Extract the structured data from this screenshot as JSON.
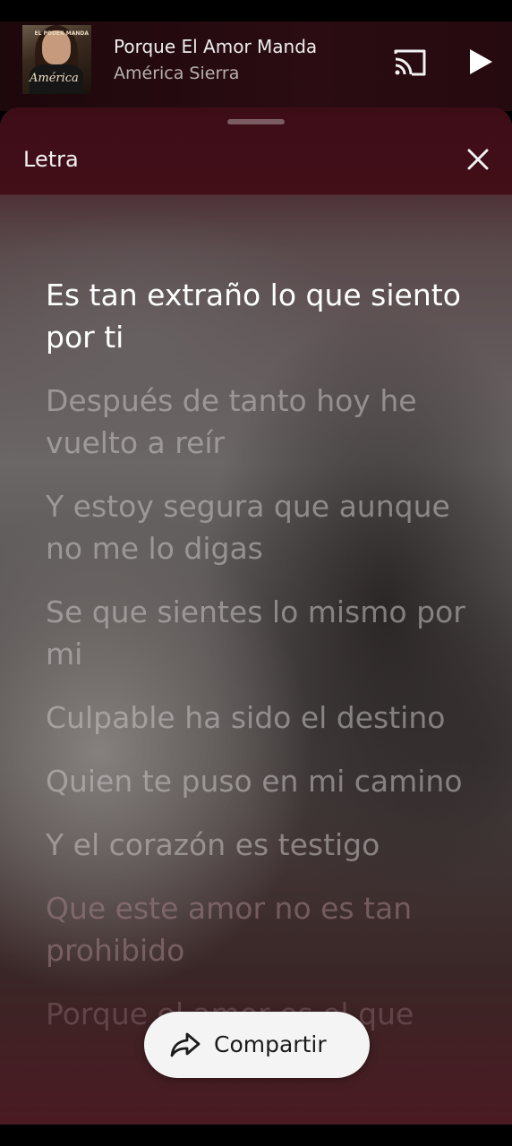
{
  "now_playing": {
    "title": "Porque El Amor Manda",
    "artist": "América Sierra",
    "album_art_tag": "EL PODER MANDA",
    "album_art_logo": "América",
    "cast_icon": "cast-icon",
    "play_icon": "play-icon"
  },
  "lyrics_sheet": {
    "title": "Letra",
    "close_icon": "close-icon",
    "lines": [
      "Es tan extraño lo que siento por ti",
      "Después de tanto hoy he vuelto a reír",
      "Y estoy segura que aunque no me lo digas",
      "Se que sientes lo mismo por mi",
      "Culpable ha sido el destino",
      "Quien te puso en mi camino",
      "Y el corazón es testigo",
      "Que este amor no es tan prohibido",
      "Porque el amor es el que"
    ],
    "current_line_index": 0,
    "share_button": {
      "label": "Compartir",
      "icon": "share-arrow-icon"
    }
  },
  "colors": {
    "accent": "#420e18",
    "current_lyric": "#ffffff",
    "inactive_lyric": "#c8c4c4"
  }
}
